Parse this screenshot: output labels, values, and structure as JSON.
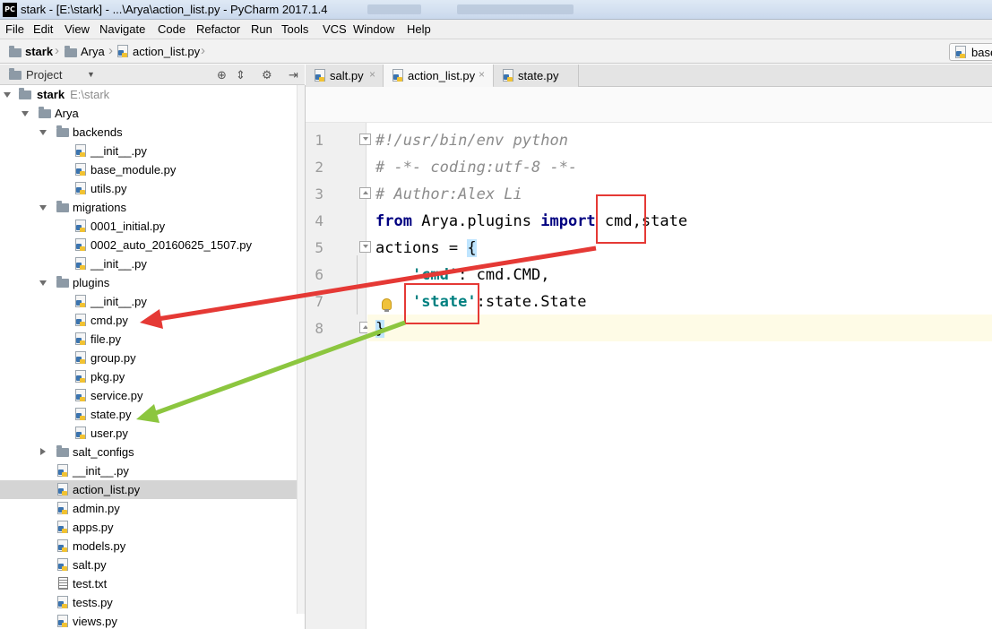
{
  "window": {
    "title": "stark - [E:\\stark] - ...\\Arya\\action_list.py - PyCharm 2017.1.4",
    "app_icon": "PC"
  },
  "menu": [
    "File",
    "Edit",
    "View",
    "Navigate",
    "Code",
    "Refactor",
    "Run",
    "Tools",
    "VCS",
    "Window",
    "Help"
  ],
  "nav": {
    "crumbs": [
      "stark",
      "Arya",
      "action_list.py"
    ],
    "right_button": "base"
  },
  "project_panel": {
    "title": "Project",
    "tree": [
      {
        "label": "stark",
        "path": "E:\\stark",
        "type": "root"
      },
      {
        "label": "Arya",
        "type": "folder"
      },
      {
        "label": "backends",
        "type": "folder"
      },
      {
        "label": "__init__.py",
        "type": "py"
      },
      {
        "label": "base_module.py",
        "type": "py"
      },
      {
        "label": "utils.py",
        "type": "py"
      },
      {
        "label": "migrations",
        "type": "folder"
      },
      {
        "label": "0001_initial.py",
        "type": "py"
      },
      {
        "label": "0002_auto_20160625_1507.py",
        "type": "py"
      },
      {
        "label": "__init__.py",
        "type": "py"
      },
      {
        "label": "plugins",
        "type": "folder"
      },
      {
        "label": "__init__.py",
        "type": "py"
      },
      {
        "label": "cmd.py",
        "type": "py"
      },
      {
        "label": "file.py",
        "type": "py"
      },
      {
        "label": "group.py",
        "type": "py"
      },
      {
        "label": "pkg.py",
        "type": "py"
      },
      {
        "label": "service.py",
        "type": "py"
      },
      {
        "label": "state.py",
        "type": "py"
      },
      {
        "label": "user.py",
        "type": "py"
      },
      {
        "label": "salt_configs",
        "type": "folder"
      },
      {
        "label": "__init__.py",
        "type": "py"
      },
      {
        "label": "action_list.py",
        "type": "py"
      },
      {
        "label": "admin.py",
        "type": "py"
      },
      {
        "label": "apps.py",
        "type": "py"
      },
      {
        "label": "models.py",
        "type": "py"
      },
      {
        "label": "salt.py",
        "type": "py"
      },
      {
        "label": "test.txt",
        "type": "txt"
      },
      {
        "label": "tests.py",
        "type": "py"
      },
      {
        "label": "views.py",
        "type": "py"
      }
    ]
  },
  "tabs": [
    "salt.py",
    "action_list.py",
    "state.py"
  ],
  "editor": {
    "line_numbers": [
      "1",
      "2",
      "3",
      "4",
      "5",
      "6",
      "7",
      "8"
    ],
    "line1": "#!/usr/bin/env python",
    "line2": "# -*- coding:utf-8 -*-",
    "line3": "# Author:Alex Li",
    "line4": {
      "kw1": "from",
      "mod": " Arya.plugins ",
      "kw2": "import",
      "sp": " ",
      "name1": "cmd",
      "rest": ",state"
    },
    "line5": {
      "text": "actions = ",
      "brace": "{"
    },
    "line6": {
      "indent": "    ",
      "key": "'cmd'",
      "rest": ": cmd.CMD,"
    },
    "line7": {
      "indent": "    ",
      "key": "'state'",
      "rest": ":state.State"
    },
    "line8": "}"
  },
  "colors": {
    "annotation_red": "#e53935",
    "annotation_green": "#8cc63f",
    "keyword": "#000080",
    "string": "#008080",
    "comment": "#8c8c8c"
  }
}
